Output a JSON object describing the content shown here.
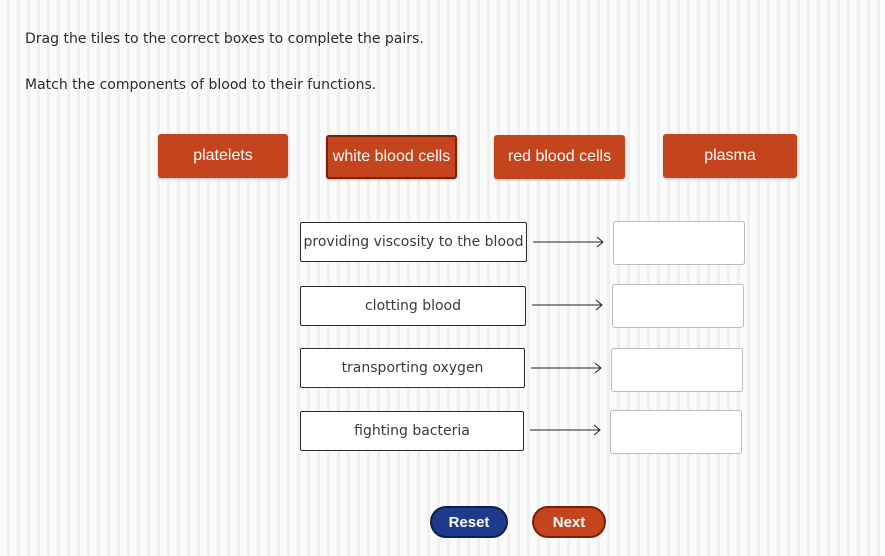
{
  "instructions": {
    "line1": "Drag the tiles to the correct boxes to complete the pairs.",
    "line2": "Match the components of blood to their functions."
  },
  "tiles": [
    {
      "label": "platelets"
    },
    {
      "label": "white blood cells"
    },
    {
      "label": "red blood cells"
    },
    {
      "label": "plasma"
    }
  ],
  "prompts": [
    {
      "label": "providing viscosity to the blood"
    },
    {
      "label": "clotting blood"
    },
    {
      "label": "transporting oxygen"
    },
    {
      "label": "fighting bacteria"
    }
  ],
  "buttons": {
    "reset": "Reset",
    "next": "Next"
  },
  "colors": {
    "tile": "#c4441e",
    "reset_button": "#1e3a8a",
    "next_button": "#c4441e"
  }
}
